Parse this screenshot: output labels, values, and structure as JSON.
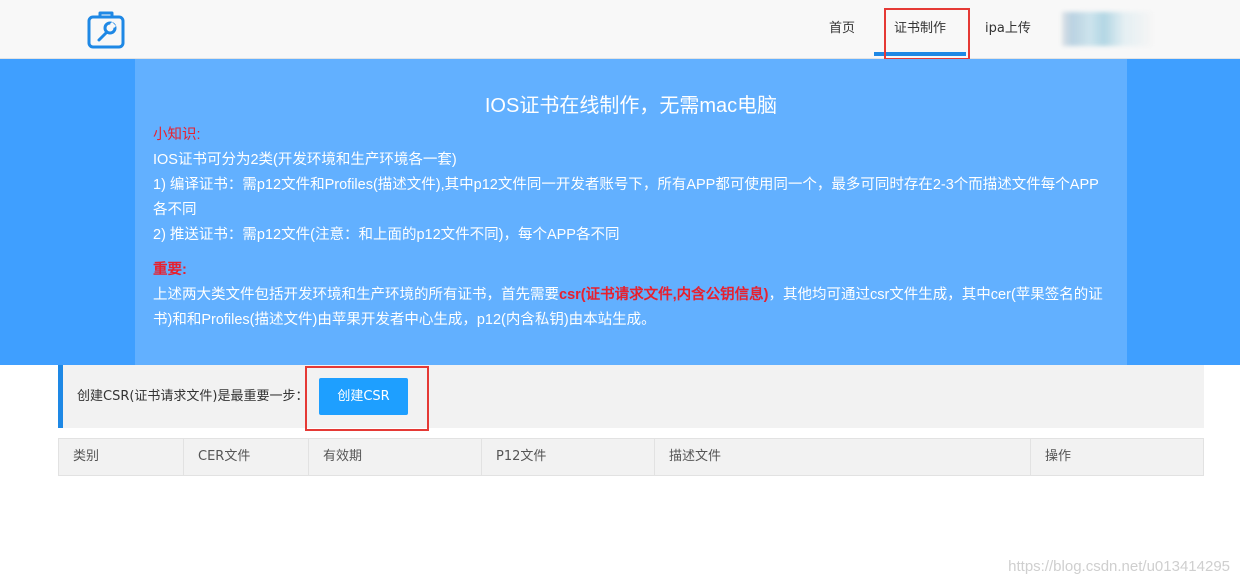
{
  "header": {
    "logo_icon": "toolbox-wrench-icon",
    "nav": [
      {
        "label": "首页"
      },
      {
        "label": "证书制作",
        "active": true
      },
      {
        "label": "ipa上传"
      }
    ],
    "accent_color": "#1e88e5"
  },
  "banner": {
    "title": "IOS证书在线制作，无需mac电脑",
    "tips_title": "小知识:",
    "tips_lines": [
      "IOS证书可分为2类(开发环境和生产环境各一套)",
      "1) 编译证书：需p12文件和Profiles(描述文件),其中p12文件同一开发者账号下，所有APP都可使用同一个，最多可同时存在2-3个而描述文件每个APP各不同",
      "2) 推送证书：需p12文件(注意：和上面的p12文件不同)，每个APP各不同"
    ],
    "important_title": "重要:",
    "important_before": "上述两大类文件包括开发环境和生产环境的所有证书，首先需要",
    "important_highlight": "csr(证书请求文件,内含公钥信息)",
    "important_after": "，其他均可通过csr文件生成，其中cer(苹果签名的证书)和和Profiles(描述文件)由苹果开发者中心生成，p12(内含私钥)由本站生成。",
    "background_color": "#3f9fff",
    "panel_color": "#62b0ff",
    "highlight_color": "#e8202e"
  },
  "csr": {
    "label": "创建CSR(证书请求文件)是最重要一步：",
    "button_label": "创建CSR",
    "button_color": "#1e9fff"
  },
  "table": {
    "columns": [
      "类别",
      "CER文件",
      "有效期",
      "P12文件",
      "描述文件",
      "操作"
    ]
  },
  "watermark": "https://blog.csdn.net/u013414295"
}
